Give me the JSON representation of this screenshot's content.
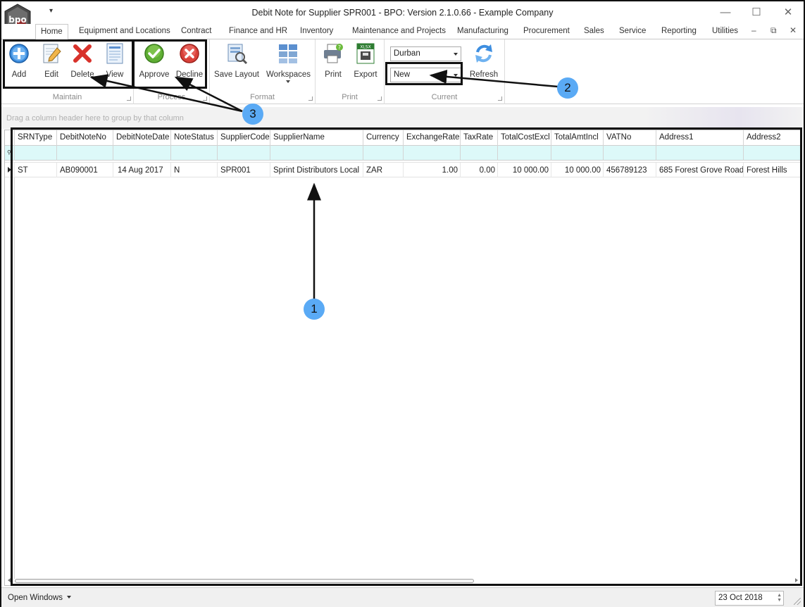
{
  "window": {
    "title": "Debit Note for Supplier SPR001 - BPO: Version 2.1.0.66 - Example Company",
    "logo_text": "bpo",
    "qat_symbol": "▾",
    "controls": {
      "minimize": "—",
      "maximize": "☐",
      "close": "✕"
    },
    "mdi_controls": {
      "minimize": "–",
      "restore": "⧉",
      "close": "✕"
    }
  },
  "tabs": [
    {
      "label": "Home",
      "active": true
    },
    {
      "label": "Equipment and Locations"
    },
    {
      "label": "Contract"
    },
    {
      "label": "Finance and HR"
    },
    {
      "label": "Inventory"
    },
    {
      "label": "Maintenance and Projects"
    },
    {
      "label": "Manufacturing"
    },
    {
      "label": "Procurement"
    },
    {
      "label": "Sales"
    },
    {
      "label": "Service"
    },
    {
      "label": "Reporting"
    },
    {
      "label": "Utilities"
    }
  ],
  "ribbon": {
    "groups": {
      "maintain": "Maintain",
      "process": "Process",
      "format": "Format",
      "print": "Print",
      "current": "Current"
    },
    "buttons": {
      "add": "Add",
      "edit": "Edit",
      "delete": "Delete",
      "view": "View",
      "approve": "Approve",
      "decline": "Decline",
      "save_layout": "Save Layout",
      "workspaces": "Workspaces",
      "print": "Print",
      "export": "Export",
      "refresh": "Refresh"
    },
    "site_select": "Durban",
    "status_select": "New",
    "export_badge": "XLSX"
  },
  "group_panel": {
    "hint": "Drag a column header here to group by that column"
  },
  "grid": {
    "columns": [
      "SRNType",
      "DebitNoteNo",
      "DebitNoteDate",
      "NoteStatus",
      "SupplierCode",
      "SupplierName",
      "Currency",
      "ExchangeRate",
      "TaxRate",
      "TotalCostExcl",
      "TotalAmtIncl",
      "VATNo",
      "Address1",
      "Address2"
    ],
    "rows": [
      [
        "ST",
        "AB090001",
        "14 Aug 2017",
        "N",
        "SPR001",
        "Sprint Distributors Local",
        "ZAR",
        "1.00",
        "0.00",
        "10 000.00",
        "10 000.00",
        "456789123",
        "685 Forest Grove Road",
        "Forest Hills"
      ]
    ]
  },
  "annotations": {
    "one": "1",
    "two": "2",
    "three": "3"
  },
  "status_bar": {
    "open_windows": "Open Windows",
    "date": "23 Oct 2018"
  },
  "colors": {
    "badge": "#5aaaf5",
    "filter_row": "#ddf9f9",
    "annotation_border": "#111111"
  }
}
